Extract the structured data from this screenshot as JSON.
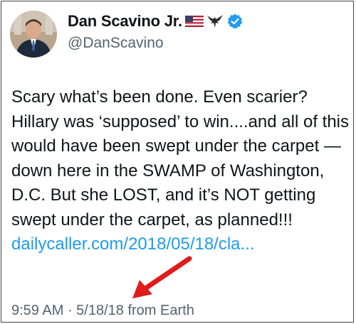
{
  "user": {
    "display_name": "Dan Scavino Jr.",
    "handle": "@DanScavino",
    "name_emojis": [
      "us-flag-icon",
      "eagle-icon"
    ],
    "verified": true
  },
  "tweet": {
    "text": "Scary what’s been done. Even scarier? Hillary was ‘supposed’ to win....and all of this would have been swept under the carpet — down here in the SWAMP of Washington, D.C. But she LOST, and it’s NOT getting swept under the carpet, as planned!!! ",
    "link_text": "dailycaller.com/2018/05/18/cla...",
    "link_color": "#1d9bf0"
  },
  "meta": {
    "time": "9:59 AM",
    "separator": " · ",
    "date": "5/18/18",
    "source": " from Earth"
  },
  "annotation": {
    "arrow_color": "#e01b1b"
  }
}
